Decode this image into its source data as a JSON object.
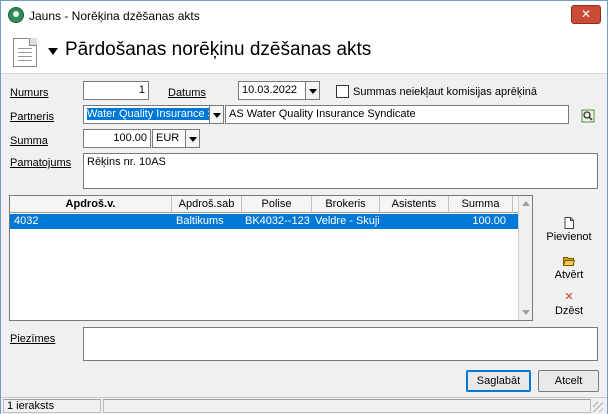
{
  "window": {
    "title": "Jauns - Norēķina dzēšanas akts",
    "close_label": "✕"
  },
  "header": {
    "title": "Pārdošanas norēķinu dzēšanas akts"
  },
  "form": {
    "numurs_label": "Numurs",
    "numurs_value": "1",
    "datums_label": "Datums",
    "datums_value": "10.03.2022",
    "checkbox_label": "Summas neiekļaut komisijas aprēķinā",
    "checkbox_checked": false,
    "partneris_label": "Partneris",
    "partneris_code": "Water Quality Insurance S",
    "partneris_name": "AS Water Quality Insurance Syndicate",
    "summa_label": "Summa",
    "summa_value": "100.00",
    "currency_value": "EUR",
    "pamatojums_label": "Pamatojums",
    "pamatojums_value": "Rēķins nr. 10AS",
    "piezimes_label": "Piezīmes",
    "piezimes_value": ""
  },
  "grid": {
    "columns": [
      "Apdroš.v.",
      "Apdroš.sab",
      "Polise",
      "Brokeris",
      "Asistents",
      "Summa"
    ],
    "rows": [
      {
        "apdros_v": "4032",
        "apdros_sab": "Baltikums",
        "polise": "BK4032--123",
        "brokeris": "Veldre - Skujin",
        "asistents": "",
        "summa": "100.00"
      }
    ]
  },
  "side_buttons": {
    "add": "Pievienot",
    "open": "Atvērt",
    "delete": "Dzēst"
  },
  "buttons": {
    "save": "Saglabāt",
    "cancel": "Atcelt"
  },
  "status": {
    "count": "1 ieraksts"
  },
  "colors": {
    "selection": "#0078d7",
    "close": "#c94c36",
    "delete_icon": "#c0392b",
    "open_icon": "#d4a017"
  }
}
